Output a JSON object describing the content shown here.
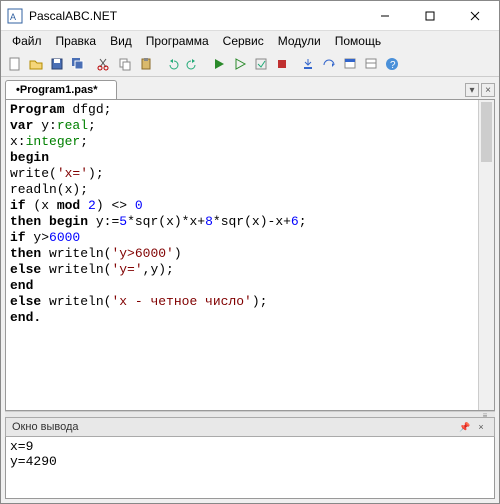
{
  "window": {
    "title": "PascalABC.NET"
  },
  "menu": {
    "file": "Файл",
    "edit": "Правка",
    "view": "Вид",
    "program": "Программа",
    "service": "Сервис",
    "modules": "Модули",
    "help": "Помощь"
  },
  "tab": {
    "name": "•Program1.pas*"
  },
  "code": {
    "l1a": "Program",
    "l1b": " dfgd;",
    "l2a": "var",
    "l2b": " y:",
    "l2c": "real",
    "l2d": ";",
    "l3a": "x:",
    "l3b": "integer",
    "l3c": ";",
    "l4": "begin",
    "l5a": "write(",
    "l5b": "'x='",
    "l5c": ");",
    "l6": "readln(x);",
    "l7a": "if",
    "l7b": " (x ",
    "l7c": "mod",
    "l7d": " ",
    "l7e": "2",
    "l7f": ") <> ",
    "l7g": "0",
    "l8a": "then",
    "l8b": " ",
    "l8c": "begin",
    "l8d": " y:=",
    "l8e": "5",
    "l8f": "*sqr(x)*x+",
    "l8g": "8",
    "l8h": "*sqr(x)-x+",
    "l8i": "6",
    "l8j": ";",
    "l9a": "if",
    "l9b": " y>",
    "l9c": "6000",
    "l10a": "then",
    "l10b": " writeln(",
    "l10c": "'y>6000'",
    "l10d": ")",
    "l11a": "else",
    "l11b": " writeln(",
    "l11c": "'y='",
    "l11d": ",y);",
    "l12": "end",
    "l13a": "else",
    "l13b": " writeln(",
    "l13c": "'x - четное число'",
    "l13d": ");",
    "l14": "end."
  },
  "output": {
    "title": "Окно вывода",
    "line1": "x=9",
    "line2": "y=4290"
  }
}
